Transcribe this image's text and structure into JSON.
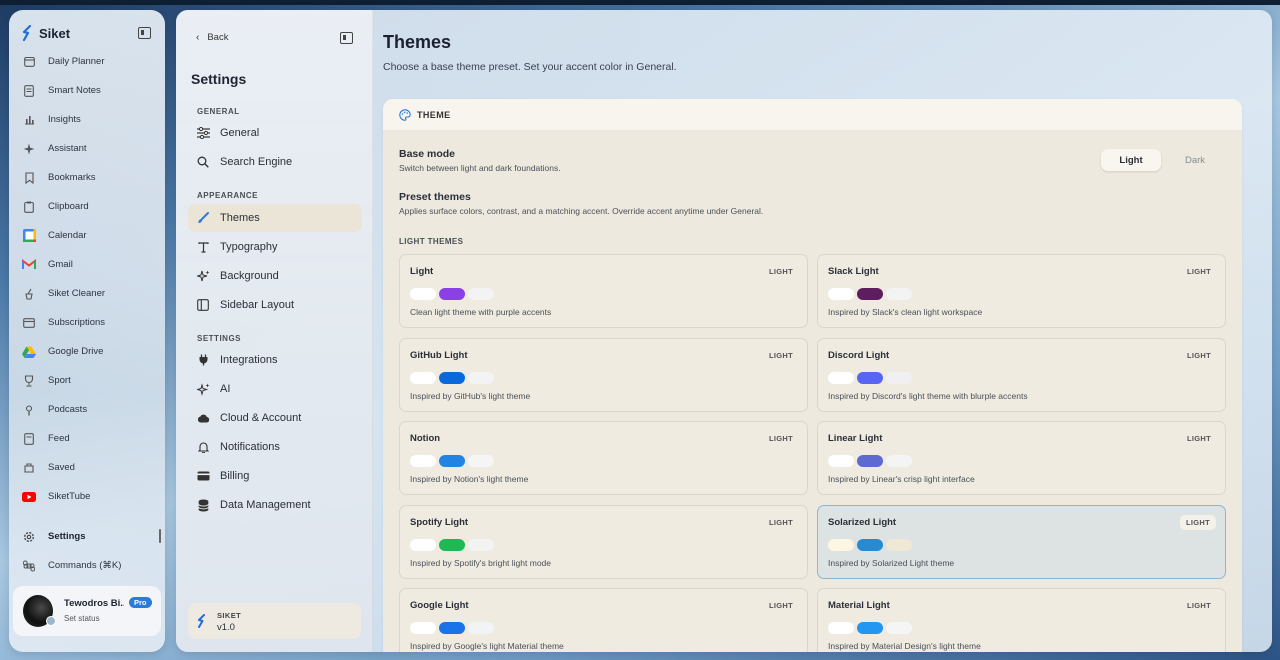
{
  "app": {
    "brand": "Siket",
    "nav": [
      {
        "label": "Daily Planner",
        "icon": "calendar-icon"
      },
      {
        "label": "Smart Notes",
        "icon": "notes-icon"
      },
      {
        "label": "Insights",
        "icon": "bar-chart-icon"
      },
      {
        "label": "Assistant",
        "icon": "sparkle-icon"
      },
      {
        "label": "Bookmarks",
        "icon": "bookmark-icon"
      },
      {
        "label": "Clipboard",
        "icon": "clipboard-icon"
      },
      {
        "label": "Calendar",
        "icon": "google-calendar-icon"
      },
      {
        "label": "Gmail",
        "icon": "gmail-icon"
      },
      {
        "label": "Siket Cleaner",
        "icon": "cleaner-icon"
      },
      {
        "label": "Subscriptions",
        "icon": "subscriptions-icon"
      },
      {
        "label": "Google Drive",
        "icon": "google-drive-icon"
      },
      {
        "label": "Sport",
        "icon": "sport-icon"
      },
      {
        "label": "Podcasts",
        "icon": "podcast-icon"
      },
      {
        "label": "Feed",
        "icon": "feed-icon"
      },
      {
        "label": "Saved",
        "icon": "saved-icon"
      },
      {
        "label": "SiketTube",
        "icon": "youtube-icon"
      }
    ],
    "settings_label": "Settings",
    "commands_label": "Commands (⌘K)",
    "profile": {
      "name": "Tewodros Bi...",
      "badge": "Pro",
      "status": "Set status"
    }
  },
  "settings_nav": {
    "back": "Back",
    "title": "Settings",
    "sections": [
      {
        "label": "GENERAL",
        "items": [
          "General",
          "Search Engine"
        ]
      },
      {
        "label": "APPEARANCE",
        "items": [
          "Themes",
          "Typography",
          "Background",
          "Sidebar Layout"
        ]
      },
      {
        "label": "SETTINGS",
        "items": [
          "Integrations",
          "AI",
          "Cloud & Account",
          "Notifications",
          "Billing",
          "Data Management"
        ]
      }
    ],
    "version": {
      "name": "SIKET",
      "value": "v1.0"
    }
  },
  "page": {
    "title": "Themes",
    "subtitle": "Choose a base theme preset. Set your accent color in General.",
    "panel_title": "THEME",
    "base_mode": {
      "title": "Base mode",
      "desc": "Switch between light and dark foundations.",
      "options": [
        "Light",
        "Dark"
      ],
      "selected": "Light"
    },
    "presets": {
      "title": "Preset themes",
      "desc": "Applies surface colors, contrast, and a matching accent. Override accent anytime under General."
    },
    "group_label": "LIGHT THEMES",
    "themes": [
      {
        "name": "Light",
        "tag": "LIGHT",
        "desc": "Clean light theme with purple accents",
        "swatches": [
          "#ffffff",
          "#8b3fe6",
          "#f3f3f3"
        ]
      },
      {
        "name": "Slack Light",
        "tag": "LIGHT",
        "desc": "Inspired by Slack's clean light workspace",
        "swatches": [
          "#ffffff",
          "#5e1d5e",
          "#f3f3f3"
        ]
      },
      {
        "name": "GitHub Light",
        "tag": "LIGHT",
        "desc": "Inspired by GitHub's light theme",
        "swatches": [
          "#ffffff",
          "#0969da",
          "#f3f3f3"
        ]
      },
      {
        "name": "Discord Light",
        "tag": "LIGHT",
        "desc": "Inspired by Discord's light theme with blurple accents",
        "swatches": [
          "#ffffff",
          "#5865f2",
          "#f0f0f2"
        ]
      },
      {
        "name": "Notion",
        "tag": "LIGHT",
        "desc": "Inspired by Notion's light theme",
        "swatches": [
          "#ffffff",
          "#2383e2",
          "#f5f5f5"
        ]
      },
      {
        "name": "Linear Light",
        "tag": "LIGHT",
        "desc": "Inspired by Linear's crisp light interface",
        "swatches": [
          "#ffffff",
          "#5e6ad2",
          "#f4f4f5"
        ]
      },
      {
        "name": "Spotify Light",
        "tag": "LIGHT",
        "desc": "Inspired by Spotify's bright light mode",
        "swatches": [
          "#ffffff",
          "#1db954",
          "#f3f3f3"
        ]
      },
      {
        "name": "Solarized Light",
        "tag": "LIGHT",
        "desc": "Inspired by Solarized Light theme",
        "swatches": [
          "#fdf6e3",
          "#268bd2",
          "#eee8d5"
        ],
        "selected": true
      },
      {
        "name": "Google Light",
        "tag": "LIGHT",
        "desc": "Inspired by Google's light Material theme",
        "swatches": [
          "#ffffff",
          "#1a73e8",
          "#f1f3f4"
        ]
      },
      {
        "name": "Material Light",
        "tag": "LIGHT",
        "desc": "Inspired by Material Design's light theme",
        "swatches": [
          "#ffffff",
          "#2196f3",
          "#f5f5f5"
        ]
      }
    ]
  },
  "colors": {
    "accent": "#2b7bd8",
    "selected_border": "#8eb6cf",
    "active_nav": "#ebe5d6"
  }
}
